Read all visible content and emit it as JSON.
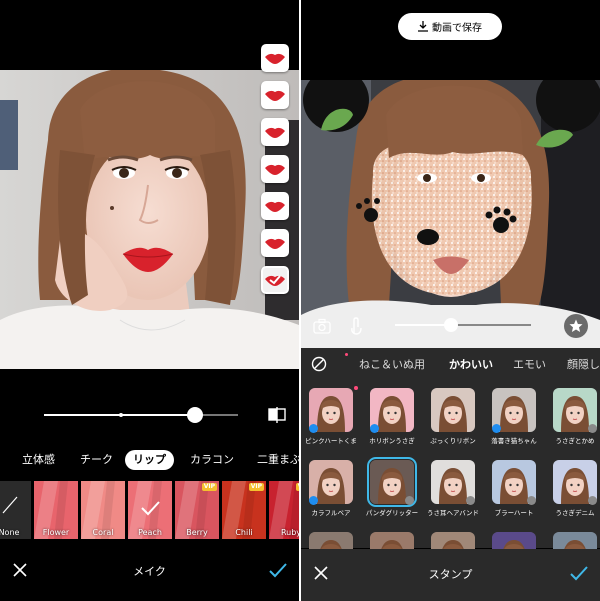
{
  "left": {
    "lip_swatch_count": 7,
    "slider_value": 0.78,
    "tabs": [
      {
        "label": "立体感",
        "active": false
      },
      {
        "label": "チーク",
        "active": false
      },
      {
        "label": "リップ",
        "active": true
      },
      {
        "label": "カラコン",
        "active": false
      },
      {
        "label": "二重まぶた",
        "active": false
      }
    ],
    "lips": [
      {
        "label": "None",
        "color": "#2b2b2b",
        "vip": false,
        "selected": false
      },
      {
        "label": "Flower",
        "color": "#e8646c",
        "vip": false,
        "selected": false
      },
      {
        "label": "Coral",
        "color": "#f08a86",
        "vip": false,
        "selected": false
      },
      {
        "label": "Peach",
        "color": "#ec6f76",
        "vip": false,
        "selected": true
      },
      {
        "label": "Berry",
        "color": "#d9555f",
        "vip": true,
        "selected": false
      },
      {
        "label": "Chili",
        "color": "#c8321e",
        "vip": true,
        "selected": false
      },
      {
        "label": "Ruby",
        "color": "#c8222f",
        "vip": true,
        "selected": false
      }
    ],
    "vip_label": "VIP",
    "bottom_title": "メイク"
  },
  "right": {
    "save_label": "動画で保存",
    "slider_value": 0.41,
    "tabs": [
      {
        "label": "ねこ＆いぬ用",
        "active": false
      },
      {
        "label": "かわいい",
        "active": true
      },
      {
        "label": "エモい",
        "active": false
      },
      {
        "label": "顔隠し",
        "active": false
      }
    ],
    "stamps": [
      {
        "name": "ピンクハートくま",
        "bg": "#e7a8b4",
        "badge": "like",
        "dot": true,
        "selected": false
      },
      {
        "name": "ホリボンうさぎ",
        "bg": "#f2b7c4",
        "badge": "like",
        "dot": false,
        "selected": false
      },
      {
        "name": "ぷっくりリボン",
        "bg": "#d8c8c0",
        "badge": "none",
        "dot": false,
        "selected": false
      },
      {
        "name": "落書き猫ちゃん",
        "bg": "#c8c3c0",
        "badge": "like",
        "dot": false,
        "selected": false
      },
      {
        "name": "うさぎとかめ",
        "bg": "#b8d8c8",
        "badge": "dl",
        "dot": false,
        "selected": false
      },
      {
        "name": "カラフルベア",
        "bg": "#d8b0a8",
        "badge": "like",
        "dot": false,
        "selected": false
      },
      {
        "name": "パンダグリッター",
        "bg": "#6a5a54",
        "badge": "dl",
        "dot": false,
        "selected": true
      },
      {
        "name": "うさ耳ヘアバンド",
        "bg": "#e0dedc",
        "badge": "dl",
        "dot": false,
        "selected": false
      },
      {
        "name": "ブラーハート",
        "bg": "#b8c8e0",
        "badge": "dl",
        "dot": false,
        "selected": false
      },
      {
        "name": "うさぎデニム",
        "bg": "#c8d0e8",
        "badge": "dl",
        "dot": false,
        "selected": false
      },
      {
        "name": "",
        "bg": "#8a7a70",
        "badge": "none",
        "dot": false,
        "selected": false
      },
      {
        "name": "",
        "bg": "#9a7a6a",
        "badge": "none",
        "dot": false,
        "selected": false
      },
      {
        "name": "",
        "bg": "#a08878",
        "badge": "none",
        "dot": false,
        "selected": false
      },
      {
        "name": "",
        "bg": "#5a4a8a",
        "badge": "none",
        "dot": false,
        "selected": false
      },
      {
        "name": "",
        "bg": "#7a8a9a",
        "badge": "none",
        "dot": false,
        "selected": false
      }
    ],
    "bottom_title": "スタンプ"
  },
  "colors": {
    "accent_blue": "#3fb8e8",
    "lip_red": "#d8222c",
    "vip_gold": "#f5c02e"
  }
}
